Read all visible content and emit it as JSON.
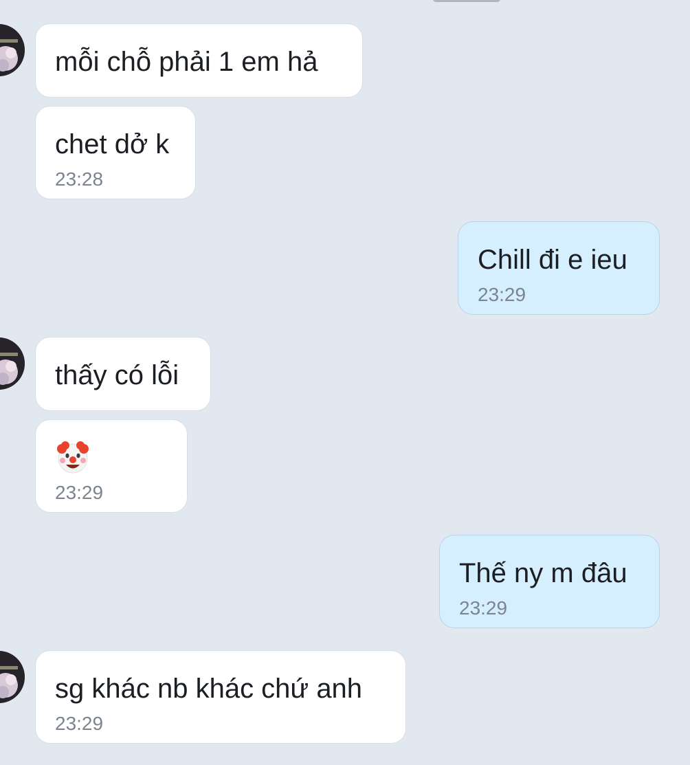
{
  "conversation": {
    "messages": [
      {
        "sender": "them",
        "text": "mỗi chỗ phải 1 em hả",
        "time": ""
      },
      {
        "sender": "them",
        "text": "chet dở k",
        "time": "23:28"
      },
      {
        "sender": "me",
        "text": "Chill đi e ieu",
        "time": "23:29"
      },
      {
        "sender": "them",
        "text": "thấy có lỗi",
        "time": ""
      },
      {
        "sender": "them",
        "text": "",
        "emoji": "clown-face-emoji",
        "time": "23:29"
      },
      {
        "sender": "me",
        "text": "Thế ny m đâu",
        "time": "23:29"
      },
      {
        "sender": "them",
        "text": "sg khác nb khác chứ anh",
        "time": "23:29"
      }
    ]
  },
  "colors": {
    "background": "#e2e8f0",
    "incoming_bubble": "#ffffff",
    "outgoing_bubble": "#d5efff",
    "timestamp": "#7c858f",
    "text": "#1b1f23"
  }
}
